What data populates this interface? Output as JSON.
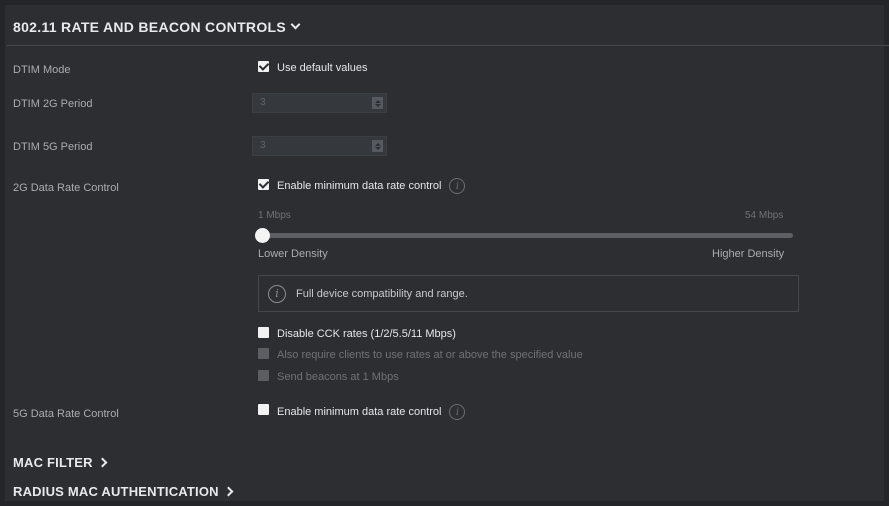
{
  "section": {
    "title": "802.11 RATE AND BEACON CONTROLS"
  },
  "dtim_mode": {
    "label": "DTIM Mode",
    "checkbox_label": "Use default values",
    "checked": true
  },
  "dtim_2g": {
    "label": "DTIM 2G Period",
    "value": "3"
  },
  "dtim_5g": {
    "label": "DTIM 5G Period",
    "value": "3"
  },
  "rate_2g": {
    "label": "2G Data Rate Control",
    "checkbox_label": "Enable minimum data rate control",
    "checked": true,
    "slider": {
      "min_label": "1 Mbps",
      "max_label": "54 Mbps",
      "value_fraction": 0,
      "left_label": "Lower Density",
      "right_label": "Higher Density"
    },
    "info_text": "Full device compatibility and range.",
    "disable_cck_label": "Disable CCK rates (1/2/5.5/11 Mbps)",
    "require_clients_label": "Also require clients to use rates at or above the specified value",
    "send_beacons_label": "Send beacons at 1 Mbps"
  },
  "rate_5g": {
    "label": "5G Data Rate Control",
    "checkbox_label": "Enable minimum data rate control",
    "checked": false
  },
  "links": {
    "mac_filter": "MAC FILTER",
    "radius_mac": "RADIUS MAC AUTHENTICATION"
  },
  "icons": {
    "info": "info-icon",
    "chevron_down": "chevron-down-icon",
    "chevron_right": "chevron-right-icon"
  },
  "colors": {
    "background": "#2c2e32",
    "text": "#e8e9eb",
    "muted": "#a9acb1"
  }
}
